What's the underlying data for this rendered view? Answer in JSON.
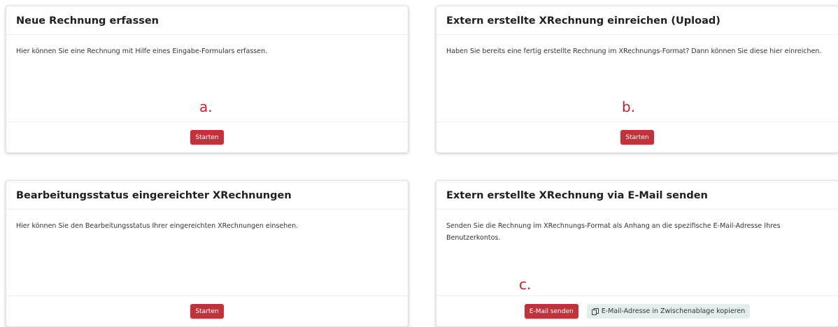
{
  "cards": {
    "new_invoice": {
      "title": "Neue Rechnung erfassen",
      "description": "Hier können Sie eine Rechnung mit Hilfe eines Eingabe-Formulars erfassen.",
      "button_label": "Starten",
      "annotation": "a."
    },
    "upload": {
      "title": "Extern erstellte XRechnung einreichen (Upload)",
      "description": "Haben Sie bereits eine fertig erstellte Rechnung im XRechnungs-Format? Dann können Sie diese hier einreichen.",
      "button_label": "Starten",
      "annotation": "b."
    },
    "status": {
      "title": "Bearbeitungsstatus eingereichter XRechnungen",
      "description": "Hier können Sie den Bearbeitungsstatus Ihrer eingereichten XRechnungen einsehen.",
      "button_label": "Starten"
    },
    "email": {
      "title": "Extern erstellte XRechnung via E-Mail senden",
      "description": "Senden Sie die Rechnung im XRechnungs-Format als Anhang an die spezifische E-Mail-Adresse Ihres Benutzerkontos.",
      "send_button_label": "E-Mail senden",
      "copy_button_label": "E-Mail-Adresse in Zwischenablage kopieren",
      "copy_icon": "copy-icon",
      "annotation": "c."
    }
  },
  "colors": {
    "primary_button": "#c0333d",
    "secondary_button": "#e3eeec",
    "annotation": "#c7202c"
  }
}
